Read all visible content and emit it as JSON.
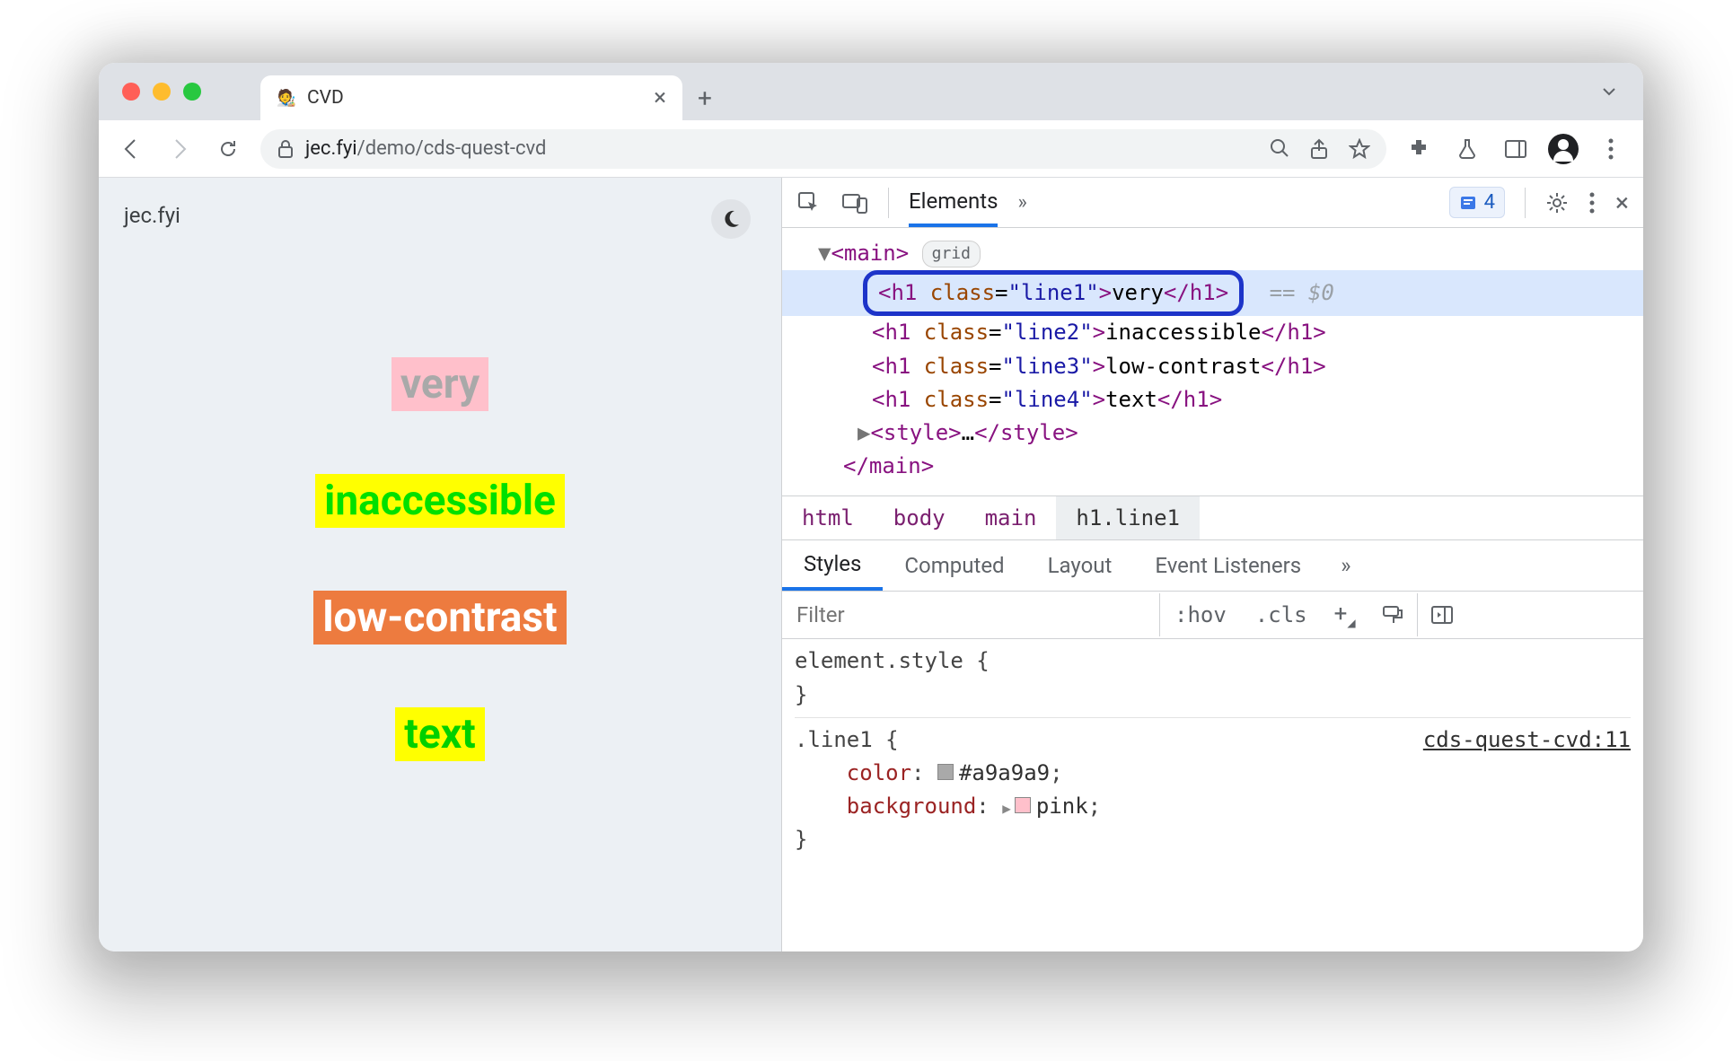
{
  "tab": {
    "title": "CVD",
    "favicon_emoji": "🧑‍🎨"
  },
  "address": {
    "host": "jec.fyi",
    "path": "/demo/cds-quest-cvd"
  },
  "page": {
    "site_label": "jec.fyi"
  },
  "demo": {
    "line1": "very",
    "line2": "inaccessible",
    "line3": "low-contrast",
    "line4": "text"
  },
  "devtools": {
    "panel": "Elements",
    "issues_count": "4",
    "dom": {
      "main_open": "<main>",
      "main_pill": "grid",
      "h1_line1": {
        "open": "<h1 class=\"line1\">",
        "text": "very",
        "close": "</h1>",
        "eq": "== $0"
      },
      "h1_line2": {
        "open": "<h1 class=\"line2\">",
        "text": "inaccessible",
        "close": "</h1>"
      },
      "h1_line3": {
        "open": "<h1 class=\"line3\">",
        "text": "low-contrast",
        "close": "</h1>"
      },
      "h1_line4": {
        "open": "<h1 class=\"line4\">",
        "text": "</h1>",
        "mid": "text"
      },
      "style_open": "<style>",
      "style_ell": "…",
      "style_close": "</style>",
      "main_close": "</main>"
    },
    "crumbs": [
      "html",
      "body",
      "main",
      "h1.line1"
    ],
    "styles_tabs": [
      "Styles",
      "Computed",
      "Layout",
      "Event Listeners"
    ],
    "filter_placeholder": "Filter",
    "hov": ":hov",
    "cls": ".cls",
    "rules": {
      "element_style": "element.style {",
      "brace_close": "}",
      "selector": ".line1 {",
      "source": "cds-quest-cvd:11",
      "p1_name": "color",
      "p1_val": "#a9a9a9",
      "p1_swatch": "#a9a9a9",
      "p2_name": "background",
      "p2_val": "pink",
      "p2_swatch": "#ffc0cb"
    }
  }
}
